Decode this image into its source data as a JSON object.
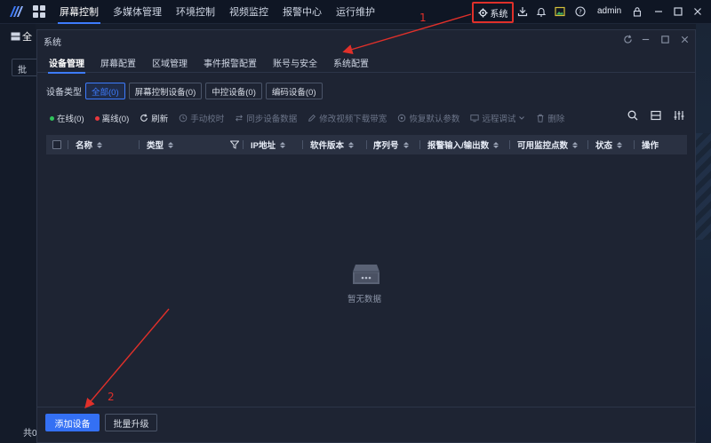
{
  "topbar": {
    "nav": [
      "屏幕控制",
      "多媒体管理",
      "环境控制",
      "视频监控",
      "报警中心",
      "运行维护"
    ],
    "active_nav": 0,
    "system_label": "系统",
    "user": "admin"
  },
  "background": {
    "title": "全",
    "input_text": "批",
    "footer_text": "共0"
  },
  "dialog": {
    "title": "系统",
    "tabs": [
      "设备管理",
      "屏幕配置",
      "区域管理",
      "事件报警配置",
      "账号与安全",
      "系统配置"
    ],
    "active_tab": 0,
    "filter": {
      "label": "设备类型",
      "chips": [
        "全部(0)",
        "屏幕控制设备(0)",
        "中控设备(0)",
        "编码设备(0)"
      ]
    },
    "toolbar": {
      "online": "在线(0)",
      "offline": "离线(0)",
      "refresh": "刷新",
      "time_sync": "手动校时",
      "sync_params": "同步设备数据",
      "modify_bw": "修改视频下载带宽",
      "restore_default": "恢复默认参数",
      "remote_debug": "远程调试",
      "delete": "删除"
    },
    "table": {
      "columns": [
        "名称",
        "类型",
        "IP地址",
        "软件版本",
        "序列号",
        "报警输入/输出数",
        "可用监控点数",
        "状态",
        "操作"
      ]
    },
    "empty_text": "暂无数据",
    "buttons": {
      "add_device": "添加设备",
      "batch_upgrade": "批量升级"
    }
  },
  "annotations": {
    "step1": "1",
    "step2": "2",
    "color": "#e0302a"
  },
  "colors": {
    "accent": "#3d7bfd",
    "online_dot": "#2fc25b",
    "offline_dot": "#e8383d"
  }
}
